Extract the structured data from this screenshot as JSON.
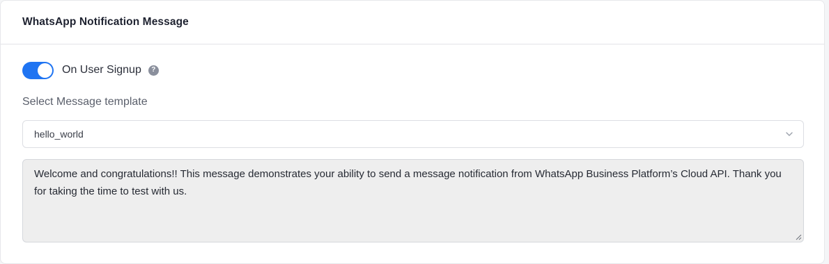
{
  "header": {
    "title": "WhatsApp Notification Message"
  },
  "toggle": {
    "label": "On User Signup",
    "checked": true,
    "help_icon": "question-circle-icon",
    "help_glyph": "?",
    "accent_color": "#1f74f2"
  },
  "template_select": {
    "label": "Select Message template",
    "value": "hello_world",
    "icon": "chevron-down-icon"
  },
  "message": {
    "text": "Welcome and congratulations!! This message demonstrates your ability to send a message notification from WhatsApp Business Platform’s Cloud API. Thank you for taking the time to test with us."
  }
}
